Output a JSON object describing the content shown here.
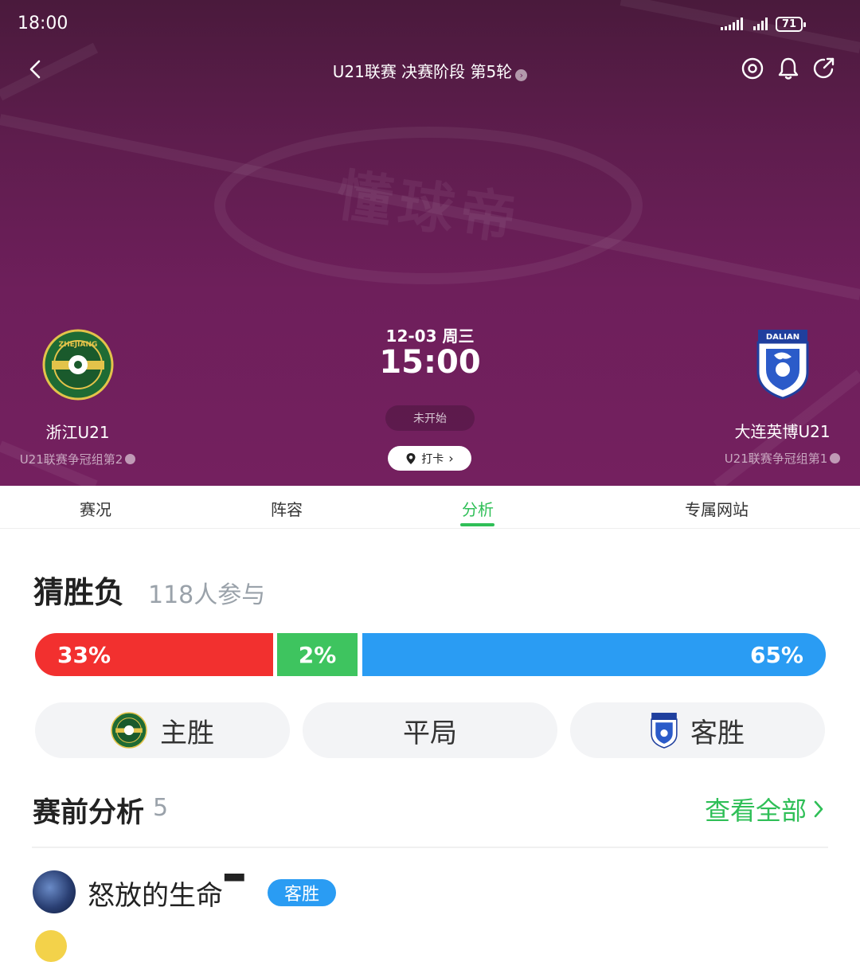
{
  "status_bar": {
    "time": "18:00",
    "battery": "71"
  },
  "nav": {
    "title": "U21联赛 决赛阶段 第5轮",
    "icons": [
      "back-icon",
      "target-icon",
      "bell-icon",
      "share-icon"
    ]
  },
  "header_watermark": "懂球帝",
  "home_team": {
    "name": "浙江U21",
    "rank": "U21联赛争冠组第2",
    "badge_text": "ZHEJIANG"
  },
  "away_team": {
    "name": "大连英博U21",
    "rank": "U21联赛争冠组第1",
    "badge_text": "DALIAN"
  },
  "match": {
    "date": "12-03 周三",
    "time": "15:00",
    "status": "未开始",
    "checkin": "打卡"
  },
  "tabs": [
    {
      "label": "赛况"
    },
    {
      "label": "阵容"
    },
    {
      "label": "分析"
    },
    {
      "label": "专属网站"
    }
  ],
  "prediction": {
    "title": "猜胜负",
    "participants": "118人参与",
    "home_pct": "33%",
    "draw_pct": "2%",
    "away_pct": "65%",
    "shares": {
      "home": 0.33,
      "draw": 0.02,
      "away": 0.65
    },
    "buttons": {
      "home": "主胜",
      "draw": "平局",
      "away": "客胜"
    }
  },
  "analysis": {
    "title": "赛前分析",
    "count": "5",
    "view_all": "查看全部",
    "first_item": {
      "user": "怒放的生命",
      "pick": "客胜"
    }
  },
  "colors": {
    "accent_green": "#2fbf57",
    "home_red": "#f2302f",
    "draw_green": "#3ec45f",
    "away_blue": "#2a9cf3",
    "header_purple": "#6e1f5b"
  }
}
